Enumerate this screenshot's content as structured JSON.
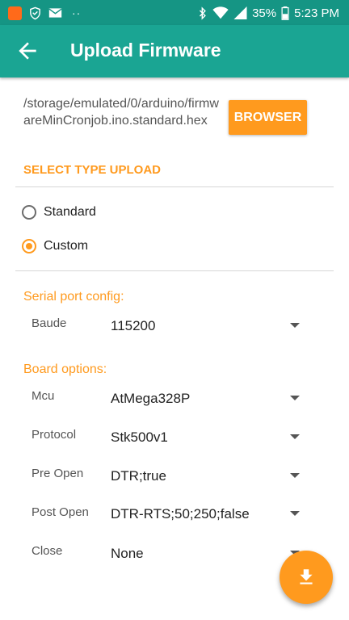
{
  "status_bar": {
    "battery_text": "35%",
    "time": "5:23 PM",
    "notification_dots": "··",
    "icons": [
      "app-notification-icon",
      "shield-icon",
      "mail-icon",
      "bluetooth-icon",
      "wifi-icon",
      "signal-icon",
      "battery-icon"
    ]
  },
  "app_bar": {
    "title": "Upload Firmware",
    "back_icon": "arrow-left-icon"
  },
  "file": {
    "path": "/storage/emulated/0/arduino/firmwareMinCronjob.ino.standard.hex",
    "browser_label": "BROWSER"
  },
  "upload_type": {
    "title": "SELECT TYPE UPLOAD",
    "options": [
      {
        "label": "Standard",
        "selected": false
      },
      {
        "label": "Custom",
        "selected": true
      }
    ]
  },
  "serial_port": {
    "title": "Serial port config:",
    "fields": [
      {
        "label": "Baude",
        "value": "115200"
      }
    ]
  },
  "board_options": {
    "title": "Board options:",
    "fields": [
      {
        "label": "Mcu",
        "value": "AtMega328P"
      },
      {
        "label": "Protocol",
        "value": "Stk500v1"
      },
      {
        "label": "Pre Open",
        "value": "DTR;true"
      },
      {
        "label": "Post Open",
        "value": "DTR-RTS;50;250;false"
      },
      {
        "label": "Close",
        "value": "None"
      }
    ]
  },
  "fab": {
    "icon": "download-icon"
  },
  "colors": {
    "primary": "#1aa593",
    "primary_dark": "#159584",
    "accent": "#ff9a1e"
  }
}
